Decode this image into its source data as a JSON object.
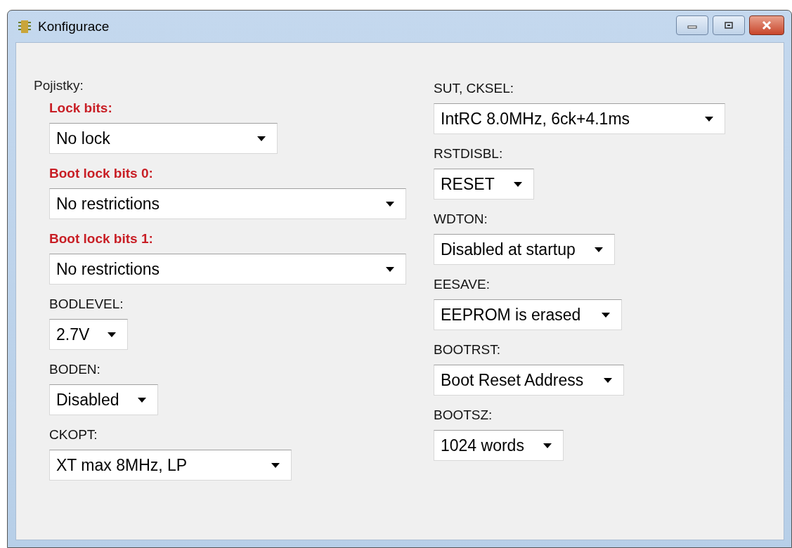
{
  "window": {
    "title": "Konfigurace"
  },
  "section_label": "Pojistky:",
  "left_fields": [
    {
      "label": "Lock bits:",
      "warning": true,
      "value": "No lock"
    },
    {
      "label": "Boot lock bits 0:",
      "warning": true,
      "value": "No restrictions"
    },
    {
      "label": "Boot lock bits 1:",
      "warning": true,
      "value": "No restrictions"
    },
    {
      "label": "BODLEVEL:",
      "warning": false,
      "value": "2.7V"
    },
    {
      "label": "BODEN:",
      "warning": false,
      "value": "Disabled"
    },
    {
      "label": "CKOPT:",
      "warning": false,
      "value": "XT max 8MHz, LP"
    }
  ],
  "right_fields": [
    {
      "label": "SUT, CKSEL:",
      "warning": false,
      "value": "IntRC 8.0MHz, 6ck+4.1ms"
    },
    {
      "label": "RSTDISBL:",
      "warning": false,
      "value": "RESET"
    },
    {
      "label": "WDTON:",
      "warning": false,
      "value": "Disabled at startup"
    },
    {
      "label": "EESAVE:",
      "warning": false,
      "value": "EEPROM is erased"
    },
    {
      "label": "BOOTRST:",
      "warning": false,
      "value": "Boot Reset Address"
    },
    {
      "label": "BOOTSZ:",
      "warning": false,
      "value": "1024 words"
    }
  ]
}
